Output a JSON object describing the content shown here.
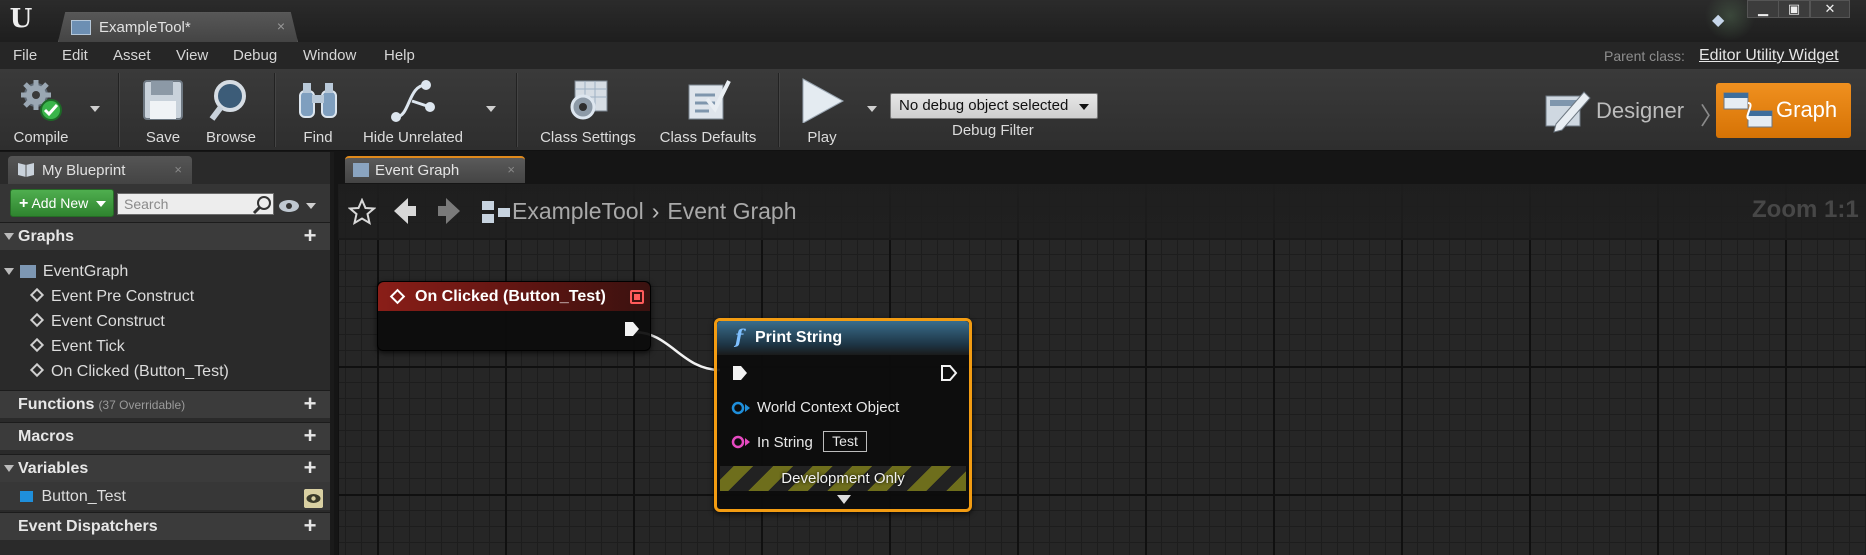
{
  "window": {
    "tab_title": "ExampleTool*",
    "tab_close": "×",
    "min": "▁",
    "max": "▣",
    "close": "✕"
  },
  "menu": {
    "items": [
      "File",
      "Edit",
      "Asset",
      "View",
      "Debug",
      "Window",
      "Help"
    ],
    "parent_class_label": "Parent class:",
    "parent_class_value": "Editor Utility Widget"
  },
  "toolbar": {
    "compile": "Compile",
    "save": "Save",
    "browse": "Browse",
    "find": "Find",
    "hide_unrelated": "Hide Unrelated",
    "class_settings": "Class Settings",
    "class_defaults": "Class Defaults",
    "play": "Play",
    "debug_select": "No debug object selected",
    "debug_filter": "Debug Filter",
    "designer": "Designer",
    "graph": "Graph",
    "mode_separator": "〉"
  },
  "my_blueprint": {
    "tab_label": "My Blueprint",
    "tab_close": "×",
    "add_new": "Add New",
    "search_placeholder": "Search",
    "sections": {
      "graphs": "Graphs",
      "functions": "Functions",
      "functions_sub": "(37 Overridable)",
      "macros": "Macros",
      "variables": "Variables",
      "event_dispatchers": "Event Dispatchers"
    },
    "graph_root": "EventGraph",
    "graph_events": [
      "Event Pre Construct",
      "Event Construct",
      "Event Tick",
      "On Clicked (Button_Test)"
    ],
    "variable": "Button_Test"
  },
  "graph_editor": {
    "tab_label": "Event Graph",
    "tab_close": "×",
    "breadcrumb_root": "ExampleTool",
    "breadcrumb_sep": "›",
    "breadcrumb_leaf": "Event Graph",
    "zoom": "Zoom 1:1"
  },
  "nodes": {
    "event": {
      "title": "On Clicked (Button_Test)"
    },
    "print_string": {
      "title": "Print String",
      "pin_world_context": "World Context Object",
      "pin_in_string": "In String",
      "in_string_value": "Test",
      "dev_only": "Development Only"
    }
  },
  "colors": {
    "accent_orange": "#e08a1c",
    "event_header": "#8a1e18",
    "function_header": "#3a6d8c",
    "add_new_green": "#3f9a3f",
    "selection_outline": "#f39c12"
  }
}
